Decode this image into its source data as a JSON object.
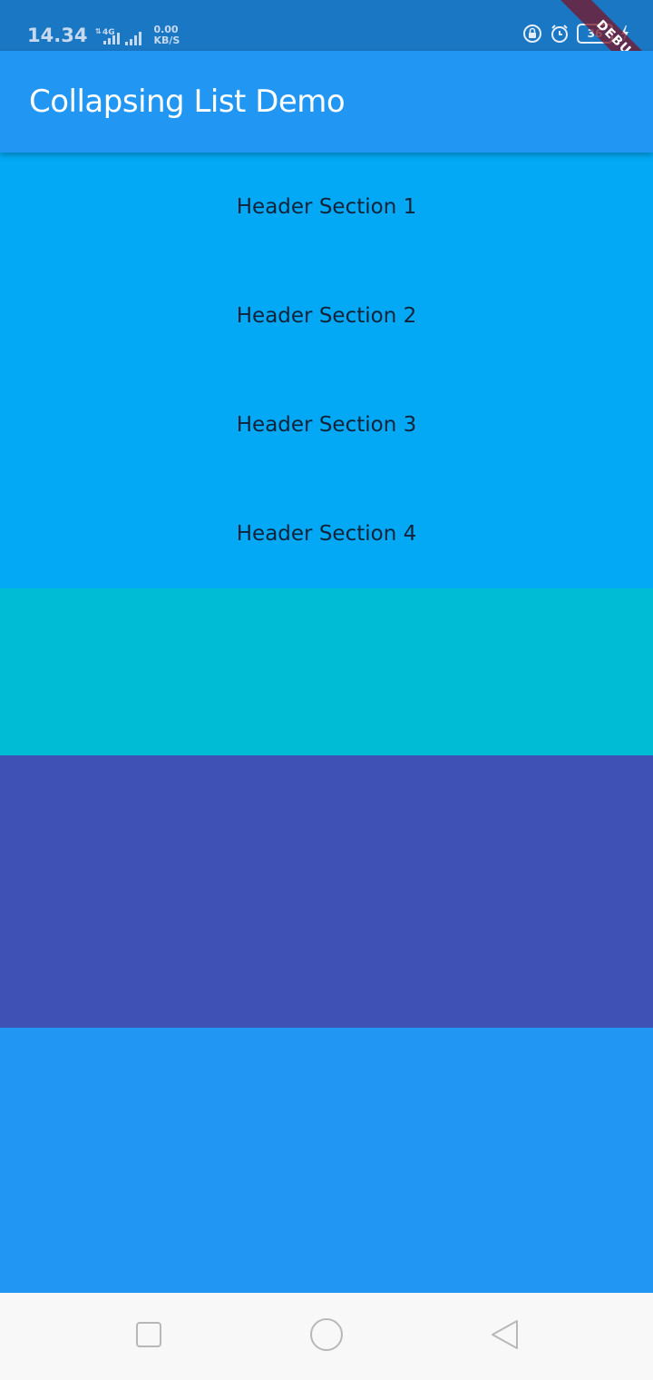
{
  "status_bar": {
    "time": "14.34",
    "network_type": "4G",
    "net_speed_value": "0.00",
    "net_speed_unit": "KB/S",
    "battery_level": "36",
    "icons": [
      "signal-4g-icon",
      "signal-icon",
      "rotation-lock-icon",
      "alarm-icon",
      "battery-icon",
      "charging-icon"
    ]
  },
  "debug_banner": {
    "label": "DEBUG"
  },
  "app_bar": {
    "title": "Collapsing List Demo"
  },
  "list": {
    "headers": [
      {
        "label": "Header Section 1"
      },
      {
        "label": "Header Section 2"
      },
      {
        "label": "Header Section 3"
      },
      {
        "label": "Header Section 4"
      }
    ]
  },
  "colors": {
    "status_bar": "#1a77c4",
    "app_bar": "#2196f3",
    "header_block": "#03a9f4",
    "cyan_block": "#00bcd4",
    "indigo_block": "#3f51b5",
    "blue_block": "#2196f3",
    "nav_bar": "#f8f8f8"
  },
  "nav_bar": {
    "icons": [
      "recents-square-icon",
      "home-circle-icon",
      "back-triangle-icon"
    ]
  }
}
